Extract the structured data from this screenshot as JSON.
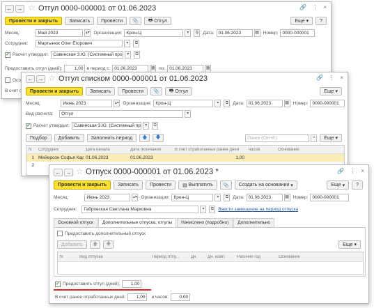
{
  "w1": {
    "title": "Отгул 0000-000001 от 01.06.2023",
    "toolbar": {
      "post_close": "Провести и закрыть",
      "save": "Записать",
      "post": "Провести",
      "print": "Отгул",
      "more": "Еще",
      "help": "?"
    },
    "month_label": "Месяц:",
    "month": "Май 2023",
    "org_label": "Организация:",
    "org": "Крон-Ц",
    "date_label": "Дата:",
    "date": "01.06.2023",
    "number_label": "Номер:",
    "number": "0000-000001",
    "employee_label": "Сотрудник:",
    "employee": "Мартынюк Олег Егорович",
    "approved_label": "Расчет утвердил:",
    "approved": "Савинская З.Ю. (Системный прог",
    "days_label": "Предоставить отгул (дней):",
    "days": "1,00",
    "period_label": "в период с:",
    "period_from": "01.06.2023",
    "po_label": "по:",
    "period_to": "01.06.2023",
    "cut1": "Особ",
    "cut2": "В счет отр"
  },
  "w2": {
    "title": "Отгул списком 0000-000001 от 01.06.2023",
    "toolbar": {
      "post_close": "Провести и закрыть",
      "save": "Записать",
      "post": "Провести",
      "print": "Отгул",
      "more": "Еще"
    },
    "month_label": "Месяц:",
    "month": "Июнь 2023",
    "org_label": "Организация:",
    "org": "Крон-Ц",
    "date_label": "Дата:",
    "date": "01.06.2023",
    "number_label": "Номер:",
    "number": "0000-000001",
    "calc_label": "Вид расчета:",
    "calc": "Отгул",
    "approved_label": "Расчет утвердил:",
    "approved": "Савинская З.Ю. (Системный прог",
    "list": {
      "pick": "Подбор",
      "add": "Добавить",
      "fill": "Заполнить период",
      "search_placeholder": "Поиск (Ctrl+F)",
      "more": "Еще"
    },
    "table": {
      "headers": [
        "N",
        "Сотрудник",
        "Дата начала",
        "Дата окончания",
        "В счет отработанных ранее дней",
        "часов",
        "Основание"
      ],
      "rows": [
        [
          "1",
          "Мейерсон Софья Кар...",
          "01.06.2023",
          "01.06.2023",
          "1,00",
          "",
          ""
        ],
        [
          "2",
          "",
          "",
          "",
          "",
          "",
          ""
        ]
      ]
    }
  },
  "w3": {
    "title": "Отпуск 0000-000001 от 01.06.2023 *",
    "toolbar": {
      "post_close": "Провести и закрыть",
      "save": "Записать",
      "post": "Провести",
      "pay": "Выплатить",
      "create_base": "Создать на основании",
      "more": "Еще",
      "help": "?"
    },
    "month_label": "Месяц:",
    "month": "Июнь 2023",
    "org_label": "Организация:",
    "org": "Крон-Ц",
    "date_label": "Дата:",
    "date": "01.06.2023",
    "number_label": "Номер:",
    "number": "0000-000001",
    "employee_label": "Сотрудник:",
    "employee": "Габровская Светлана Марковна",
    "replace_link": "Ввести замещение на период отпуска",
    "tabs": [
      "Основной отпуск",
      "Дополнительные отпуска, отгулы",
      "Начислено (подробно)",
      "Дополнительно"
    ],
    "extra_check": "Предоставить дополнительный отпуск",
    "add": "Добавить",
    "more": "Еще",
    "table_headers": [
      "N",
      "Вид отпуска",
      "Период отпу...",
      "Дн.",
      "Дн. комп.",
      "Рабочий год",
      "Основание"
    ],
    "dayoff_label": "Предоставить отгул (дней):",
    "dayoff_days": "1,00",
    "worked_label": "В счет ранее отработанных дней:",
    "worked_days": "1,00",
    "hours_label": "и часов:",
    "hours": "0,00"
  }
}
